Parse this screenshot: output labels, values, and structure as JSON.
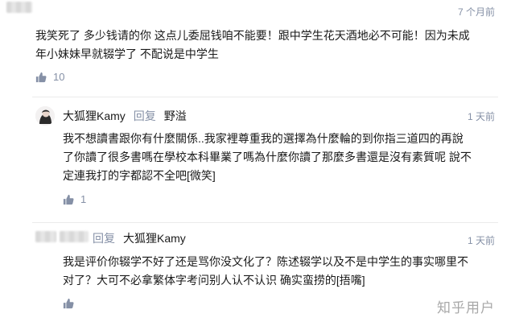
{
  "top_comment": {
    "time": "7 个月前",
    "text_lines": [
      "我笑死了 多少钱请的你 这点儿委屈钱咱不能要！跟中学生花天酒地必不可能！因为未成",
      "年小妹妹早就辍学了 不配说是中学生"
    ],
    "likes": "10"
  },
  "reply_1": {
    "author": "大狐狸Kamy",
    "reply_label": "回复",
    "reply_to": "野溢",
    "time": "1 天前",
    "text_lines": [
      "我不想讀書跟你有什麼關係..我家裡尊重我的選擇為什麼輪的到你指三道四的再說",
      "了你讀了很多書嗎在學校本科畢業了嗎為什麼你讀了那麼多書還是沒有素質呢 說不",
      "定連我打的字都認不全吧[微笑]"
    ],
    "likes": "1"
  },
  "reply_2": {
    "reply_label": "回复",
    "reply_to": "大狐狸Kamy",
    "time": "1 天前",
    "text_lines": [
      "我是评价你辍学不好了还是骂你没文化了？陈述辍学以及不是中学生的事实哪里不",
      "对了？大可不必拿繁体字考问别人认不认识 确实蛮捞的[捂嘴]"
    ]
  },
  "watermark": "知乎用户",
  "icons": {
    "like": "thumbs-up-icon"
  },
  "colors": {
    "meta_gray": "#8590a6",
    "text": "#1a1a1a"
  }
}
